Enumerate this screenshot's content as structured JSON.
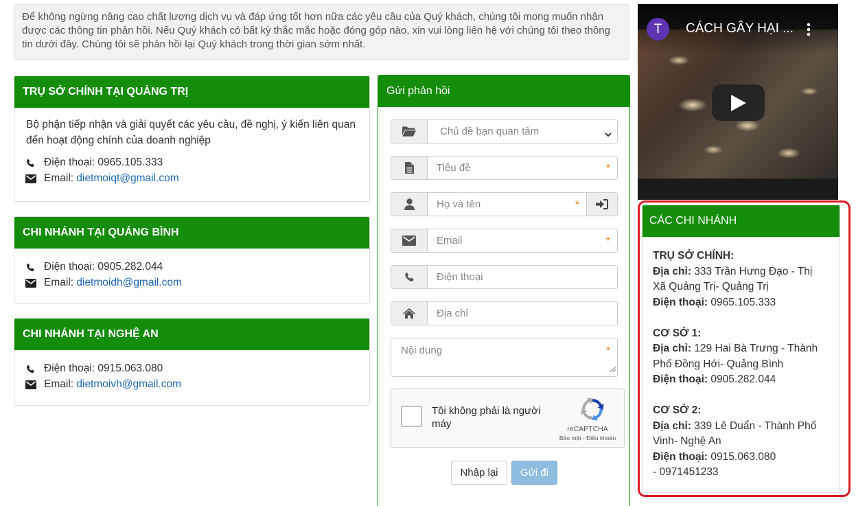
{
  "intro": {
    "text": "Để không ngừng nâng cao chất lượng dịch vụ và đáp ứng tốt hơn nữa các yêu cầu của Quý khách, chúng tôi mong muốn nhận được các thông tin phản hồi. Nếu Quý khách có bất kỳ thắc mắc hoặc đóng góp nào, xin vui lòng liên hệ với chúng tôi theo thông tin dưới đây. Chúng tôi sẽ phản hồi lại Quý khách trong thời gian sớm nhất."
  },
  "hq": {
    "title": "TRỤ SỞ CHÍNH TẠI QUẢNG TRỊ",
    "desc": "Bộ phận tiếp nhận và giải quyết các yêu cầu, đề nghị, ý kiến liên quan đến hoạt động chính của doanh nghiệp",
    "phone": "Điện thoại: 0965.105.333",
    "email_label": "Email: ",
    "email": "dietmoiqt@gmail.com"
  },
  "qb": {
    "title": "CHI NHÁNH TẠI QUẢNG BÌNH",
    "phone": "Điện thoại: 0905.282.044",
    "email_label": "Email: ",
    "email": "dietmoidh@gmail.com"
  },
  "na": {
    "title": "CHI NHÁNH TẠI NGHỆ AN",
    "phone": "Điện thoại: 0915.063.080",
    "email_label": "Email: ",
    "email": "dietmoivh@gmail.com"
  },
  "form": {
    "title": "Gửi phản hồi",
    "topic": "Chủ đề bạn quan tâm",
    "subject_placeholder": "Tiêu đề",
    "name_placeholder": "Họ và tên",
    "email_placeholder": "Email",
    "phone_placeholder": "Điện thoại",
    "address_placeholder": "Địa chỉ",
    "content_placeholder": "Nội dung",
    "required_mark": "*",
    "captcha_label": "Tôi không phải là người máy",
    "captcha_brand": "reCAPTCHA",
    "captcha_terms": "Bảo mật - Điều khoản",
    "reset_label": "Nhập lại",
    "send_label": "Gửi đi"
  },
  "video": {
    "avatar_letter": "T",
    "title": "CÁCH GÂY HẠI ..."
  },
  "branches": {
    "title": "CÁC CHI NHÁNH",
    "hq_heading": "TRỤ SỞ CHÍNH:",
    "addr_label": "Địa chỉ:",
    "phone_label": "Điện thoại:",
    "hq_addr_1": " 333 Trần Hưng Đạo - Thị",
    "hq_addr_2": "Xã Quảng Trị- Quảng Trị",
    "hq_phone": " 0965.105.333",
    "b1_heading": "CƠ SỞ 1:",
    "b1_addr_1": " 129 Hai Bà Trưng - Thành",
    "b1_addr_2": "Phố Đồng Hới- Quảng Bình",
    "b1_phone": " 0905.282.044",
    "b2_heading": "CƠ SỞ 2:",
    "b2_addr_1": " 339 Lê Duẩn - Thành Phố",
    "b2_addr_2": "Vinh- Nghệ An",
    "b2_phone": " 0915.063.080",
    "b2_phone_extra": "- 0971451233"
  },
  "colors": {
    "header_green": "#138d0a",
    "link_blue": "#1d66b8",
    "highlight_red": "#e01b24",
    "required_orange": "#f0801a"
  }
}
